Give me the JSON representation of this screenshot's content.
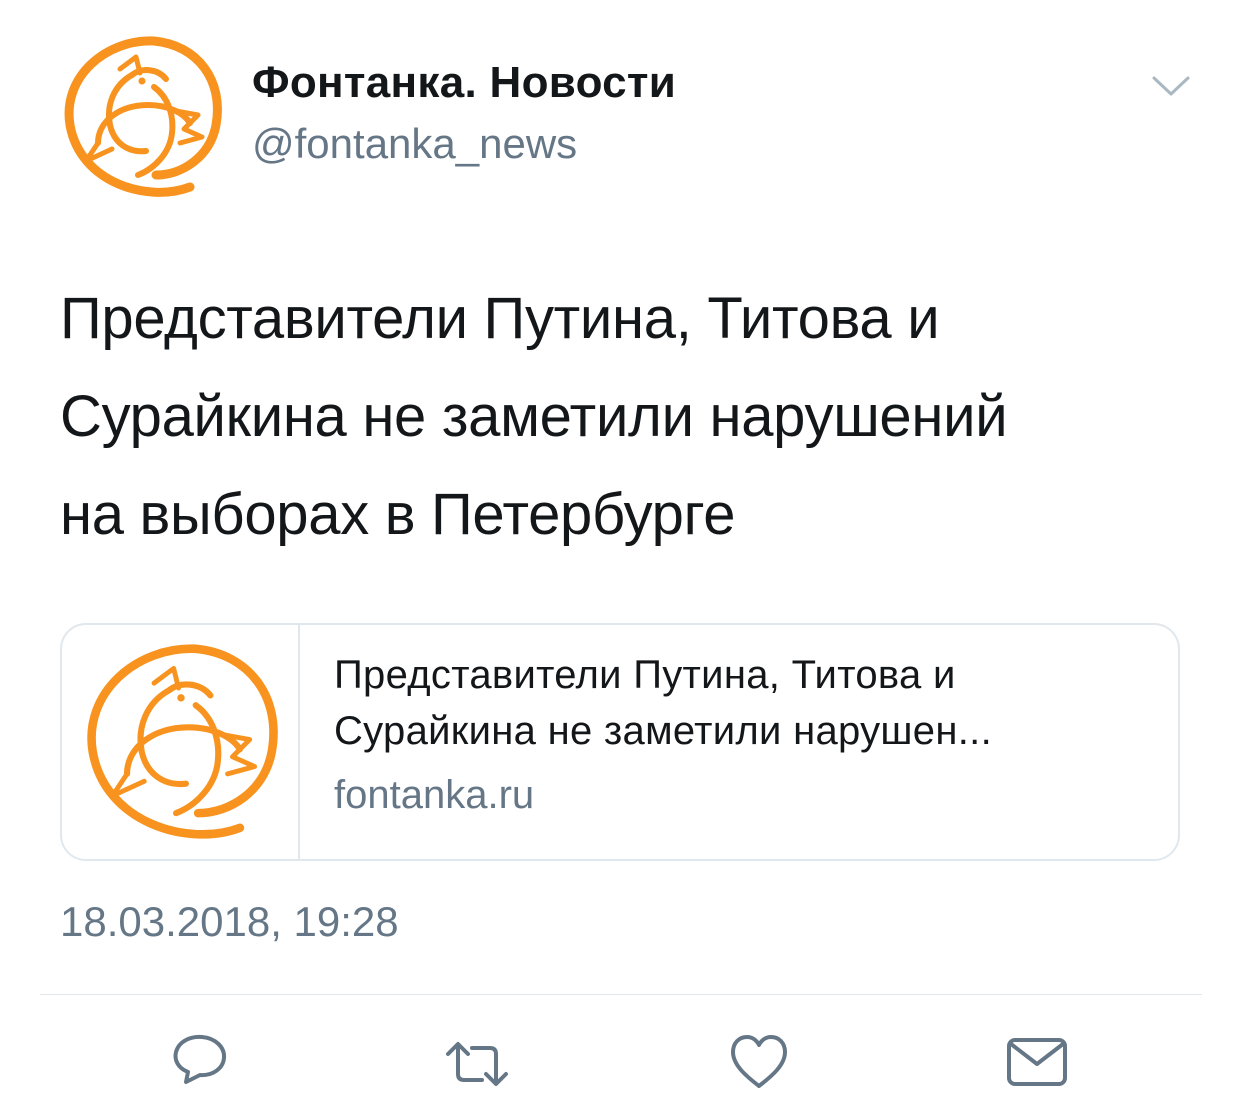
{
  "author": {
    "name": "Фонтанка. Новости",
    "handle": "@fontanka_news",
    "avatar_icon": "fontanka-bird-logo-icon",
    "brand_color": "#f7931e"
  },
  "tweet": {
    "lines": [
      "Представители Путина, Титова и",
      "Сурайкина не заметили нарушений",
      "на выборах в Петербурге"
    ]
  },
  "card": {
    "title_lines": [
      "Представители Путина, Титова и",
      "Сурайкина не заметили нарушен..."
    ],
    "domain": "fontanka.ru"
  },
  "timestamp": "18.03.2018, 19:28",
  "actions": [
    {
      "icon": "reply-icon"
    },
    {
      "icon": "retweet-icon"
    },
    {
      "icon": "like-icon"
    },
    {
      "icon": "share-dm-icon"
    }
  ],
  "colors": {
    "text": "#14171a",
    "secondary": "#657786",
    "border": "#e1e8ed",
    "icon": "#657786"
  }
}
